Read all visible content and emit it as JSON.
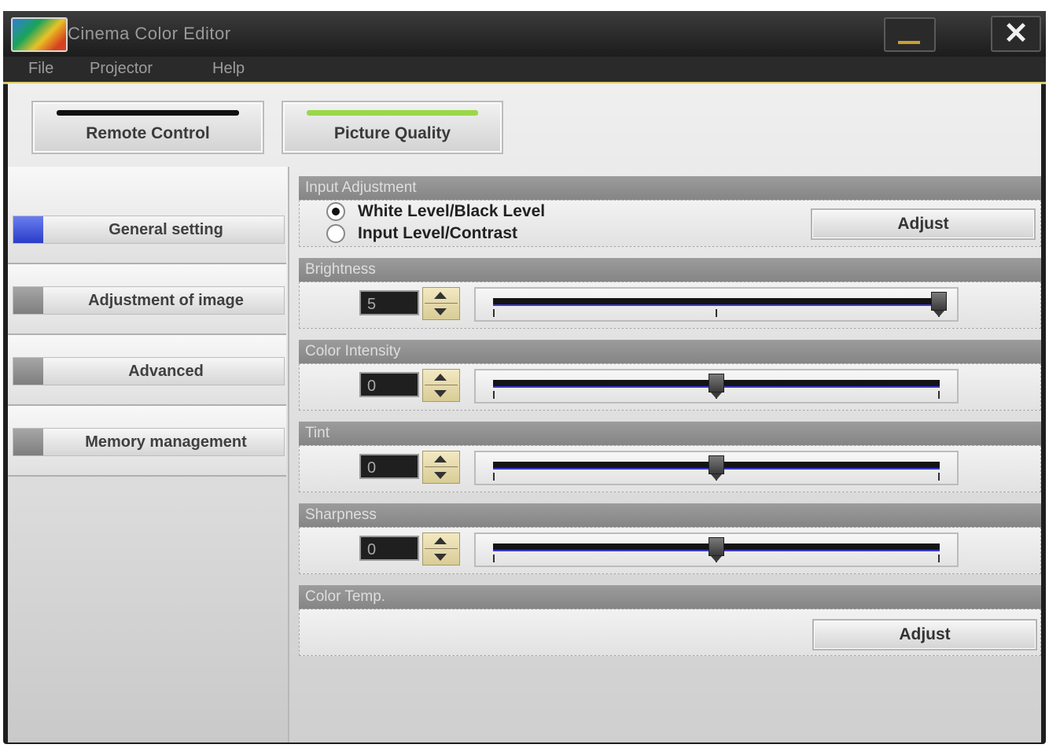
{
  "window": {
    "title": "Cinema Color Editor"
  },
  "menu": {
    "items": [
      "File",
      "Projector",
      "Help"
    ]
  },
  "top_tabs": {
    "remote_control": "Remote Control",
    "picture_quality": "Picture Quality",
    "colors": {
      "remote_bar": "#111111",
      "picture_bar": "#9ad84a"
    }
  },
  "sidebar": {
    "items": [
      {
        "label": "General setting",
        "active": true
      },
      {
        "label": "Adjustment of image",
        "active": false
      },
      {
        "label": "Advanced",
        "active": false
      },
      {
        "label": "Memory management",
        "active": false
      }
    ],
    "colors": {
      "active": "#3a4cd8",
      "inactive": "#8e8e8e"
    }
  },
  "input_adjustment": {
    "header": "Input Adjustment",
    "options": [
      {
        "label": "White Level/Black Level",
        "selected": true
      },
      {
        "label": "Input Level/Contrast",
        "selected": false
      }
    ],
    "adjust_label": "Adjust"
  },
  "sliders": [
    {
      "header": "Brightness",
      "value": "5",
      "min": -5,
      "max": 5
    },
    {
      "header": "Color Intensity",
      "value": "0",
      "min": -5,
      "max": 5
    },
    {
      "header": "Tint",
      "value": "0",
      "min": -5,
      "max": 5
    },
    {
      "header": "Sharpness",
      "value": "0",
      "min": -5,
      "max": 5
    }
  ],
  "color_temp": {
    "header": "Color Temp.",
    "adjust_label": "Adjust"
  }
}
